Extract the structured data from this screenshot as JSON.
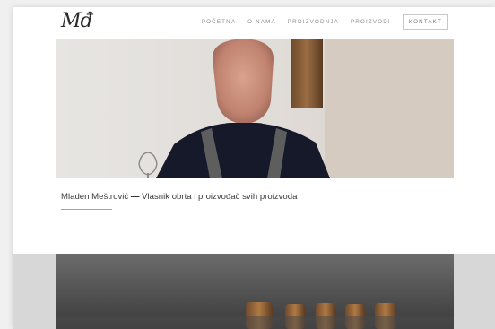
{
  "header": {
    "logo_text": "Mđ",
    "nav": [
      {
        "label": "POČETNA"
      },
      {
        "label": "O NAMA"
      },
      {
        "label": "PROIZVODNJA"
      },
      {
        "label": "PROIZVODI"
      },
      {
        "label": "KONTAKT"
      }
    ]
  },
  "hero": {
    "image_subject": "portrait of a man in a dark sweater holding a wine glass"
  },
  "caption": {
    "name": "Mladen Meštrović",
    "separator": "—",
    "role": "Vlasnik obrta i proizvođač svih proizvoda"
  },
  "section2": {
    "image_subject": "dark photo of wine bottles on a table"
  },
  "colors": {
    "accent": "#c89a6a",
    "nav_text": "#8c8c8c",
    "page_background": "#f0f0f0"
  }
}
